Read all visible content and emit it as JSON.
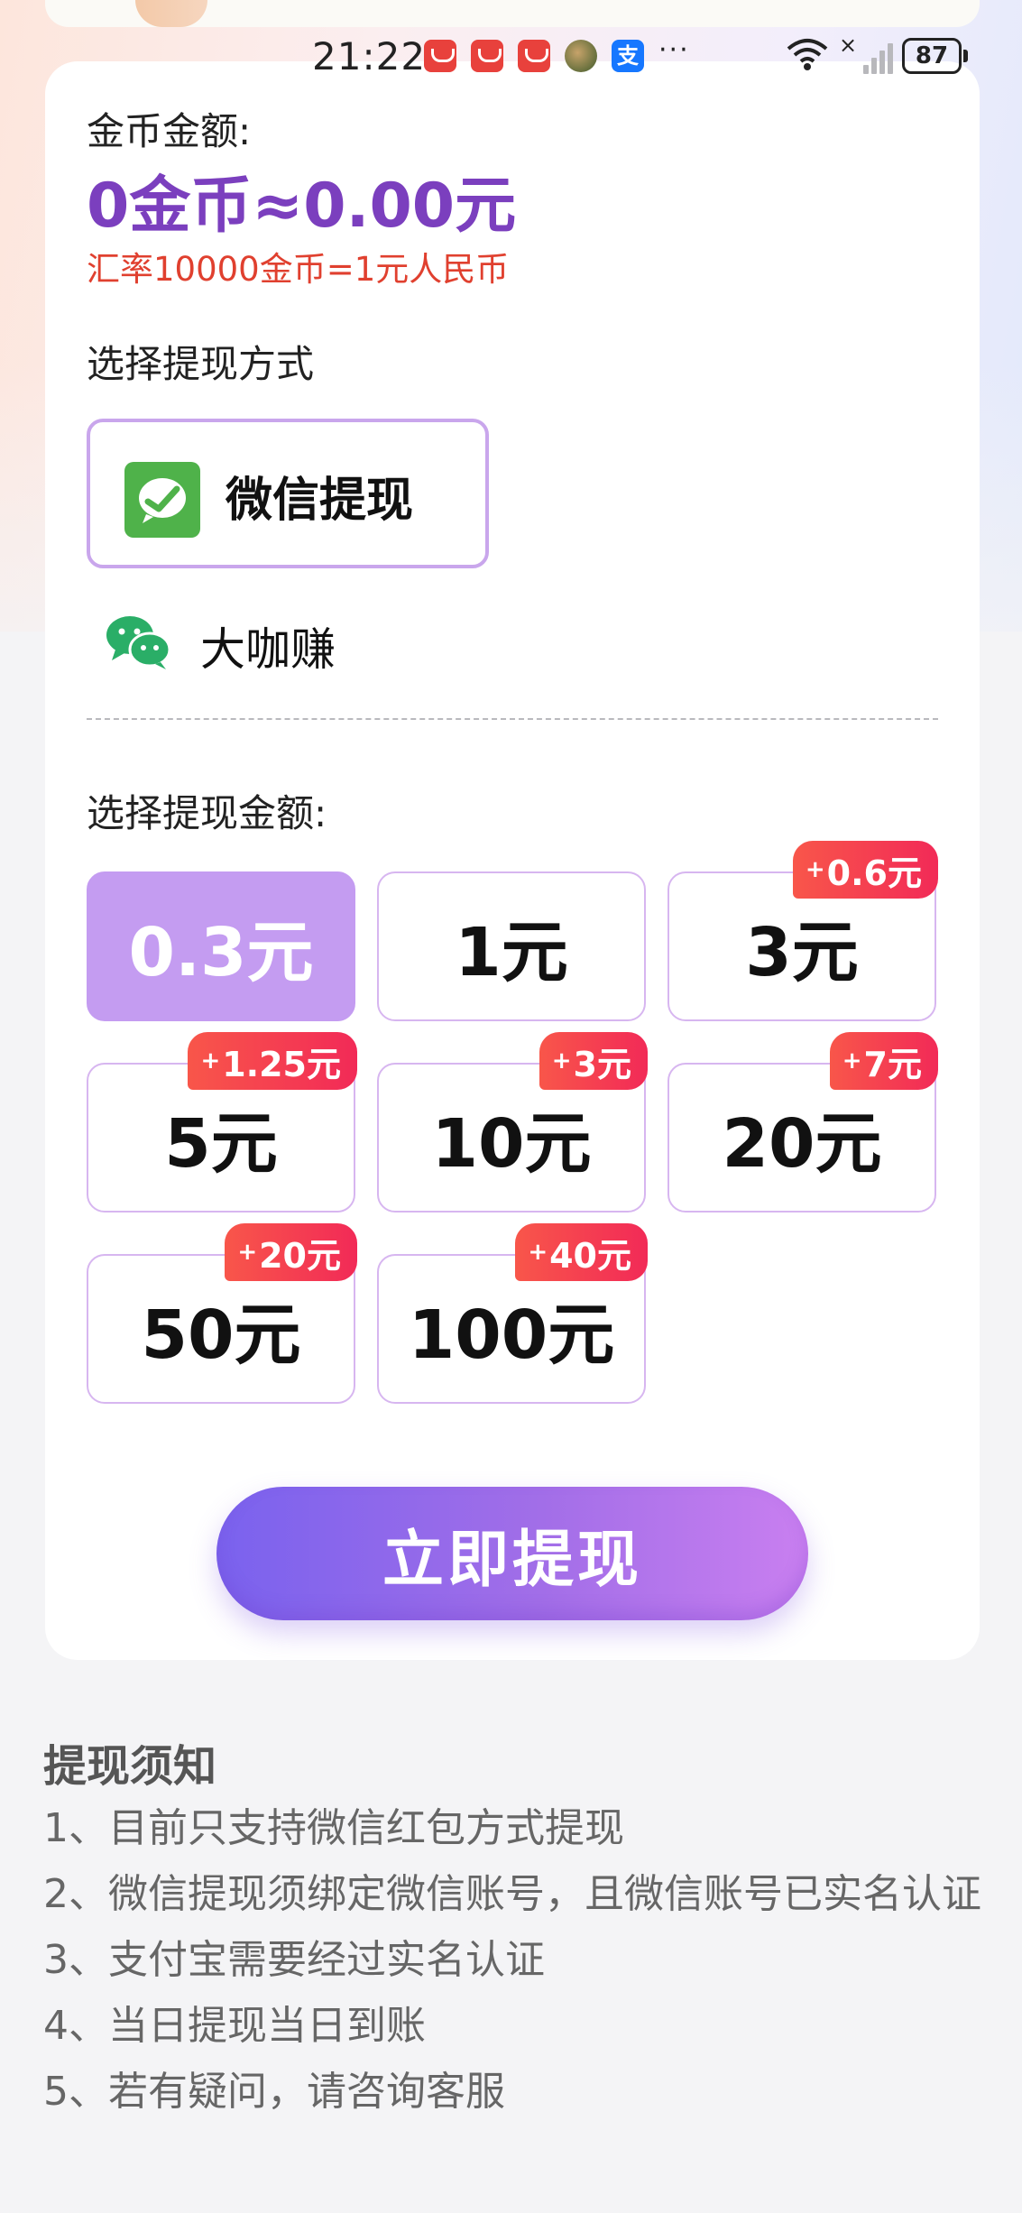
{
  "status_bar": {
    "time": "21:22",
    "battery": "87",
    "overflow": "···",
    "alipay_glyph": "支"
  },
  "card": {
    "coin_label": "金币金额:",
    "coin_amount": "0金币≈0.00元",
    "rate": "汇率10000金币=1元人民币",
    "method_label": "选择提现方式",
    "method_option": "微信提现",
    "account_name": "大咖赚",
    "amount_label": "选择提现金额:",
    "amounts": [
      {
        "label": "0.3元",
        "bonus": null,
        "selected": true
      },
      {
        "label": "1元",
        "bonus": null,
        "selected": false
      },
      {
        "label": "3元",
        "bonus": "0.6元",
        "selected": false
      },
      {
        "label": "5元",
        "bonus": "1.25元",
        "selected": false
      },
      {
        "label": "10元",
        "bonus": "3元",
        "selected": false
      },
      {
        "label": "20元",
        "bonus": "7元",
        "selected": false
      },
      {
        "label": "50元",
        "bonus": "20元",
        "selected": false
      },
      {
        "label": "100元",
        "bonus": "40元",
        "selected": false
      }
    ],
    "bonus_plus": "+",
    "withdraw_button": "立即提现"
  },
  "notice": {
    "title": "提现须知",
    "items": [
      "1、目前只支持微信红包方式提现",
      "2、微信提现须绑定微信账号，且微信账号已实名认证",
      "3、支付宝需要经过实名认证",
      "4、当日提现当日到账",
      "5、若有疑问，请咨询客服"
    ]
  },
  "colors": {
    "accent_purple": "#7b3fbe",
    "selected_amount": "#c49cf1",
    "rate_red": "#e0402f",
    "bonus_red": "#f22a57",
    "wechat_green": "#4fb24a"
  }
}
